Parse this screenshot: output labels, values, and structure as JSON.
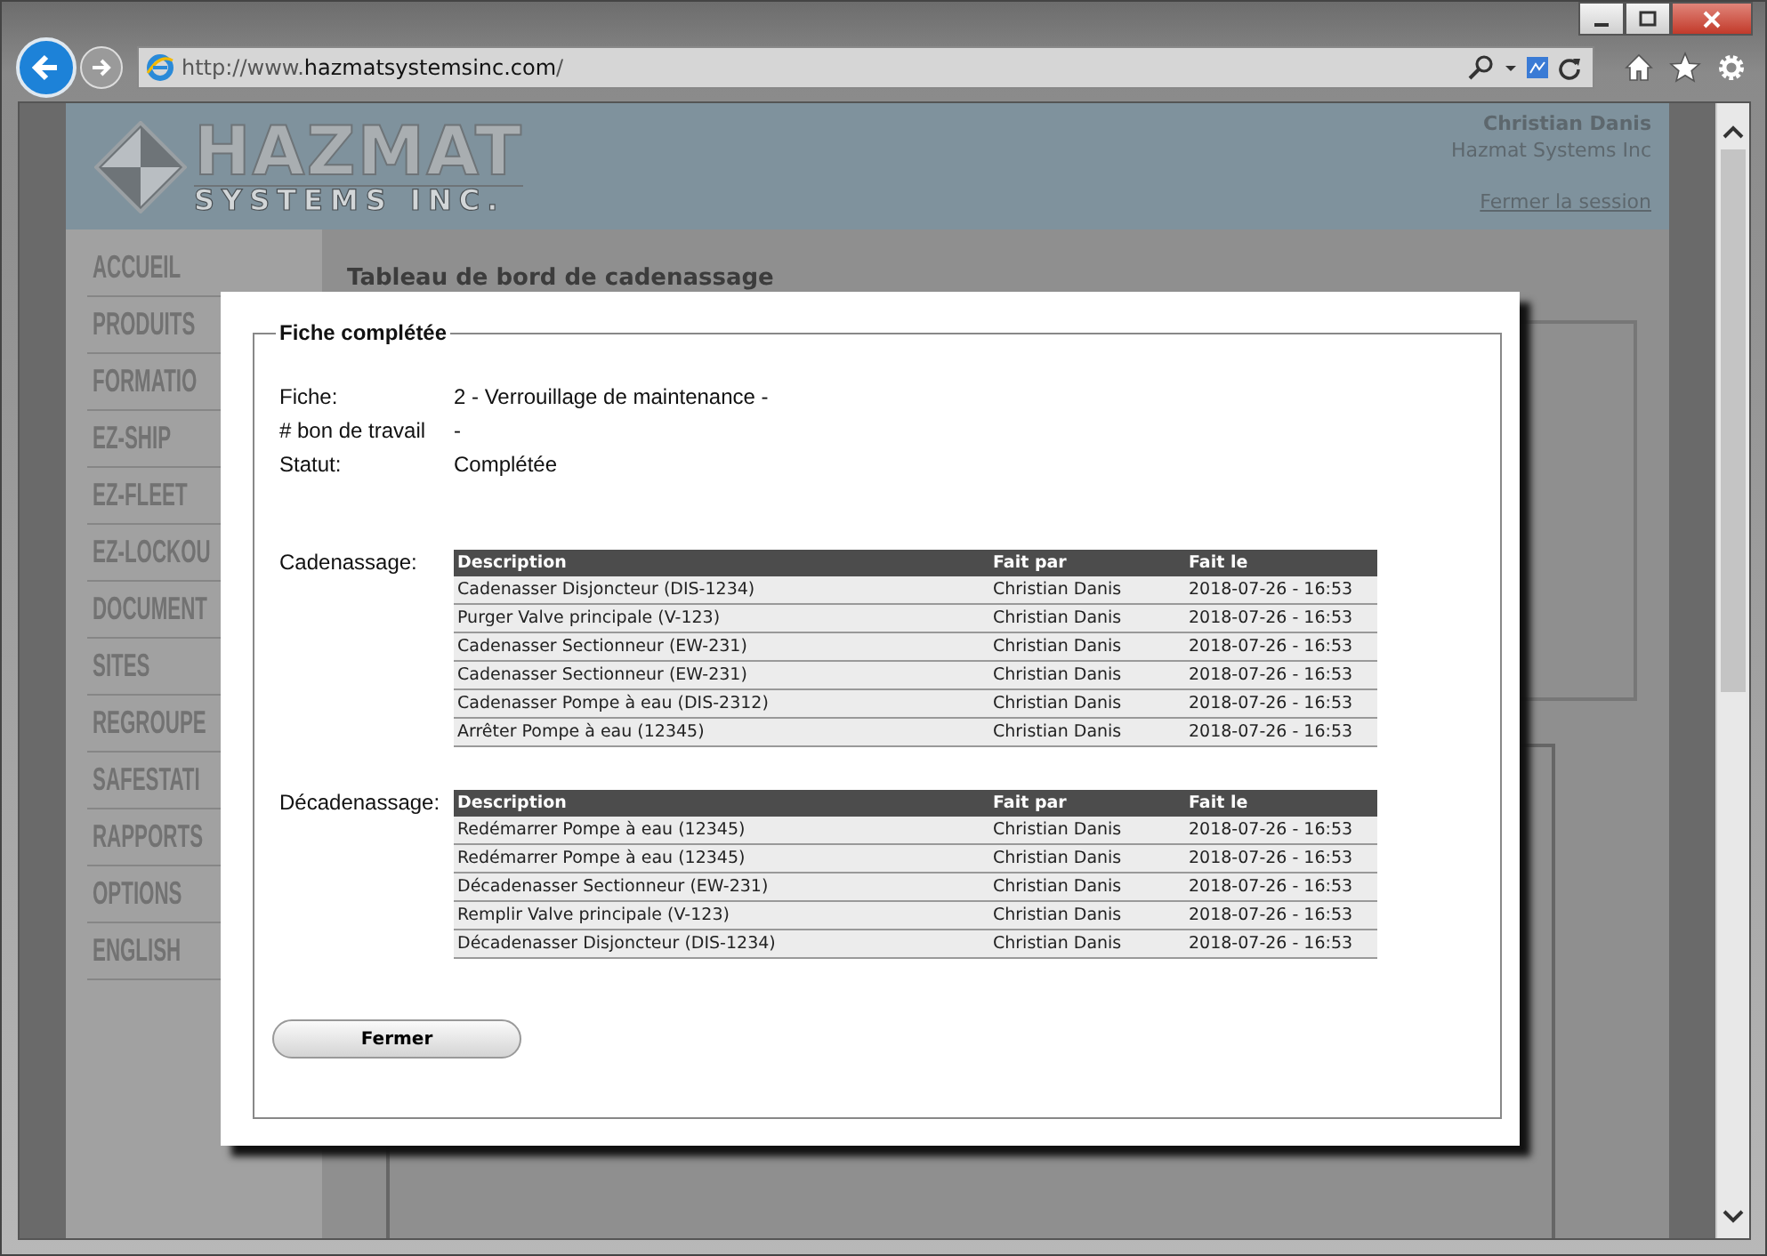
{
  "browser": {
    "url": "http://www.**hazmatsystemsinc.com**/"
  },
  "header": {
    "logo_title": "HAZMAT",
    "logo_subtitle": "SYSTEMS INC.",
    "user_name": "Christian Danis",
    "company": "Hazmat Systems Inc",
    "logout": "Fermer la session"
  },
  "sidebar": {
    "items": [
      "ACCUEIL",
      "PRODUITS",
      "FORMATIO",
      "EZ-SHIP",
      "EZ-FLEET",
      "EZ-LOCKOU",
      "DOCUMENT",
      "SITES",
      "REGROUPE",
      "SAFESTATI",
      "RAPPORTS",
      "OPTIONS",
      "ENGLISH"
    ]
  },
  "page_title": "Tableau de bord de cadenassage",
  "dialog": {
    "legend": "Fiche complétée",
    "fields": [
      {
        "label": "Fiche:",
        "value": "2 - Verrouillage de maintenance -"
      },
      {
        "label": "# bon de travail",
        "value": "-"
      },
      {
        "label": "Statut:",
        "value": "Complétée"
      }
    ],
    "tables": [
      {
        "label": "Cadenassage:",
        "columns": [
          "Description",
          "Fait par",
          "Fait le"
        ],
        "rows": [
          [
            "Cadenasser Disjoncteur (DIS-1234)",
            "Christian Danis",
            "2018-07-26 - 16:53"
          ],
          [
            "Purger Valve principale (V-123)",
            "Christian Danis",
            "2018-07-26 - 16:53"
          ],
          [
            "Cadenasser Sectionneur (EW-231)",
            "Christian Danis",
            "2018-07-26 - 16:53"
          ],
          [
            "Cadenasser Sectionneur (EW-231)",
            "Christian Danis",
            "2018-07-26 - 16:53"
          ],
          [
            "Cadenasser Pompe à eau (DIS-2312)",
            "Christian Danis",
            "2018-07-26 - 16:53"
          ],
          [
            "Arrêter Pompe à eau (12345)",
            "Christian Danis",
            "2018-07-26 - 16:53"
          ]
        ]
      },
      {
        "label": "Décadenassage:",
        "columns": [
          "Description",
          "Fait par",
          "Fait le"
        ],
        "rows": [
          [
            "Redémarrer Pompe à eau (12345)",
            "Christian Danis",
            "2018-07-26 - 16:53"
          ],
          [
            "Redémarrer Pompe à eau (12345)",
            "Christian Danis",
            "2018-07-26 - 16:53"
          ],
          [
            "Décadenasser Sectionneur (EW-231)",
            "Christian Danis",
            "2018-07-26 - 16:53"
          ],
          [
            "Remplir Valve principale (V-123)",
            "Christian Danis",
            "2018-07-26 - 16:53"
          ],
          [
            "Décadenasser Disjoncteur (DIS-1234)",
            "Christian Danis",
            "2018-07-26 - 16:53"
          ]
        ]
      }
    ],
    "close_button": "Fermer"
  }
}
